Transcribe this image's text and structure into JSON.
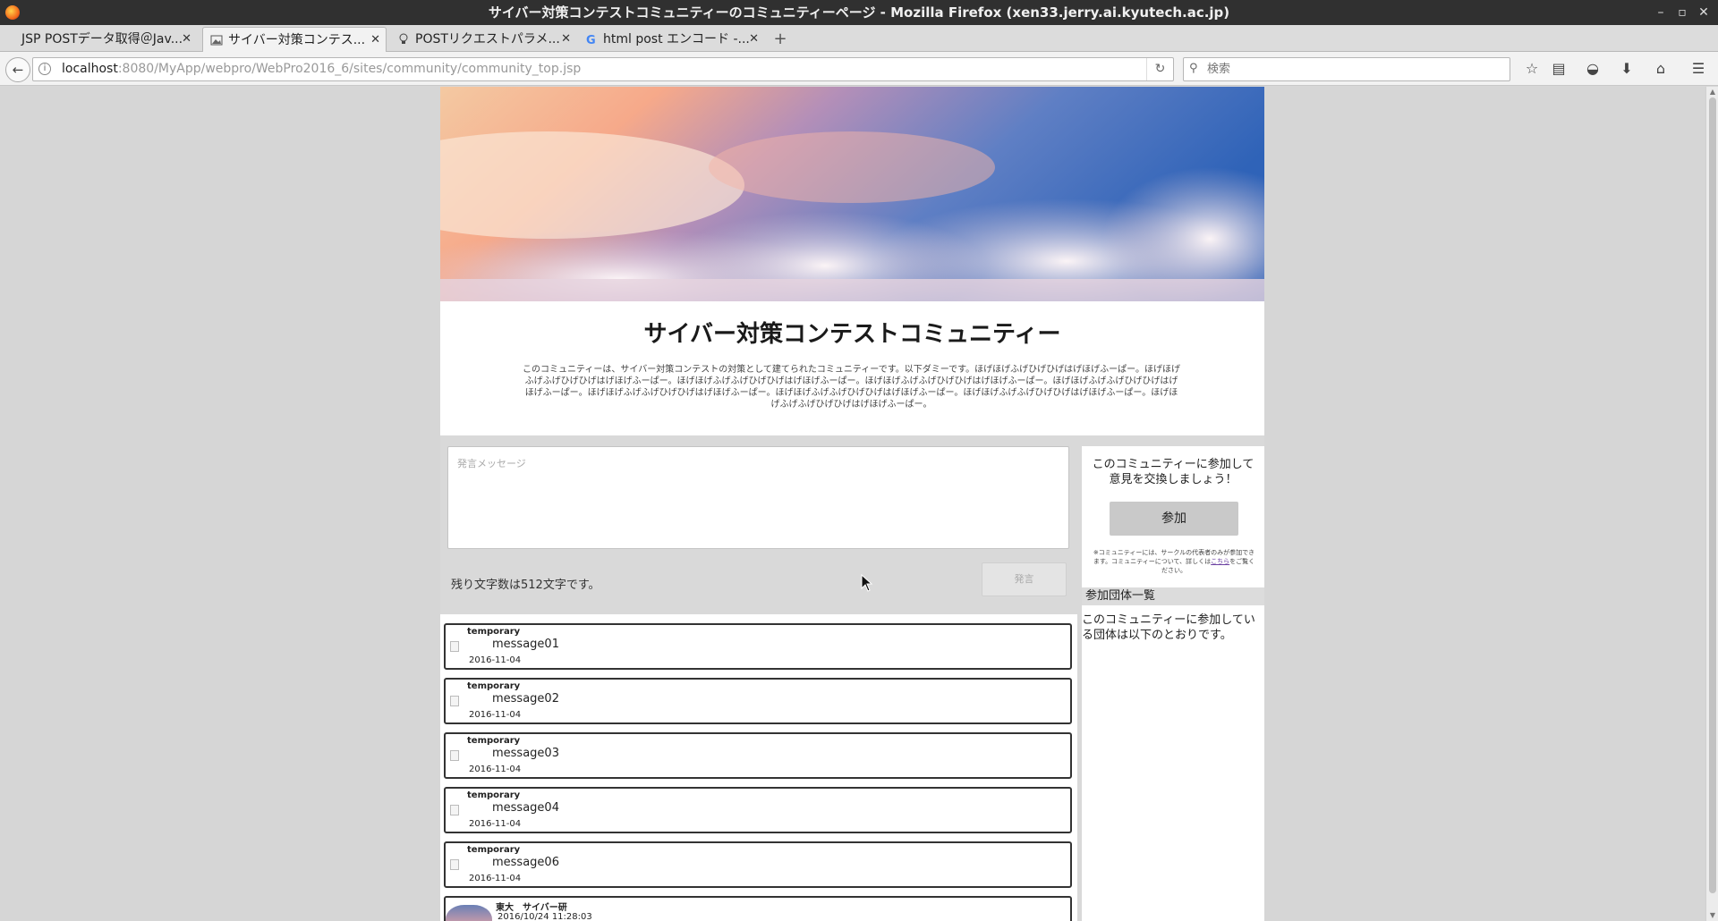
{
  "window": {
    "title": "サイバー対策コンテストコミュニティーのコミュニティーページ - Mozilla Firefox (xen33.jerry.ai.kyutech.ac.jp)",
    "controls": {
      "minimize": "–",
      "maximize": "▫",
      "close": "✕"
    }
  },
  "tabs": [
    {
      "label": "JSP POSTデータ取得＠Jav...",
      "icon": "page-icon",
      "active": false
    },
    {
      "label": "サイバー対策コンテス...",
      "icon": "image-icon",
      "active": true
    },
    {
      "label": "POSTリクエストパラメ...",
      "icon": "bulb-icon",
      "active": false
    },
    {
      "label": "html post エンコード -...",
      "icon": "google-icon",
      "active": false
    }
  ],
  "newtab_label": "+",
  "navbar": {
    "url_host": "localhost",
    "url_rest": ":8080/MyApp/webpro/WebPro2016_6/sites/community/community_top.jsp",
    "search_placeholder": "検索"
  },
  "community": {
    "title": "サイバー対策コンテストコミュニティー",
    "description": "このコミュニティーは、サイバー対策コンテストの対策として建てられたコミュニティーです。以下ダミーです。ほげほげふげひげひげはげほげふーぱー。ほげほげふげふげひげひげはげほげふーぱー。ほげほげふげふげひげひげはげほげふーぱー。ほげほげふげふげひげひげはげほげふーぱー。ほげほげふげふげひげひげはげほげふーぱー。ほげほげふげふげひげひげはげほげふーぱー。ほげほげふげふげひげひげはげほげふーぱー。ほげほげふげふげひげひげはげほげふーぱー。ほげほげふげふげひげひげはげほげふーぱー。"
  },
  "post": {
    "placeholder": "発言メッセージ",
    "remaining": "残り文字数は512文字です。",
    "submit_label": "発言"
  },
  "sidebar": {
    "join_message_line1": "このコミュニティーに参加して",
    "join_message_line2": "意見を交換しましょう！",
    "join_label": "参加",
    "note_prefix": "※コミュニティーには、サークルの代表者のみが参加できます。コミュニティーについて、詳しくは",
    "note_link": "こちら",
    "note_suffix": "をご覧ください。",
    "groups_heading": "参加団体一覧",
    "groups_desc": "このコミュニティーに参加している団体は以下のとおりです。"
  },
  "messages": [
    {
      "user": "temporary",
      "text": "message01",
      "date": "2016-11-04"
    },
    {
      "user": "temporary",
      "text": "message02",
      "date": "2016-11-04"
    },
    {
      "user": "temporary",
      "text": "message03",
      "date": "2016-11-04"
    },
    {
      "user": "temporary",
      "text": "message04",
      "date": "2016-11-04"
    },
    {
      "user": "temporary",
      "text": "message06",
      "date": "2016-11-04"
    },
    {
      "user": "東大　サイバー研",
      "text": "",
      "date": "2016/10/24 11:28:03"
    }
  ]
}
